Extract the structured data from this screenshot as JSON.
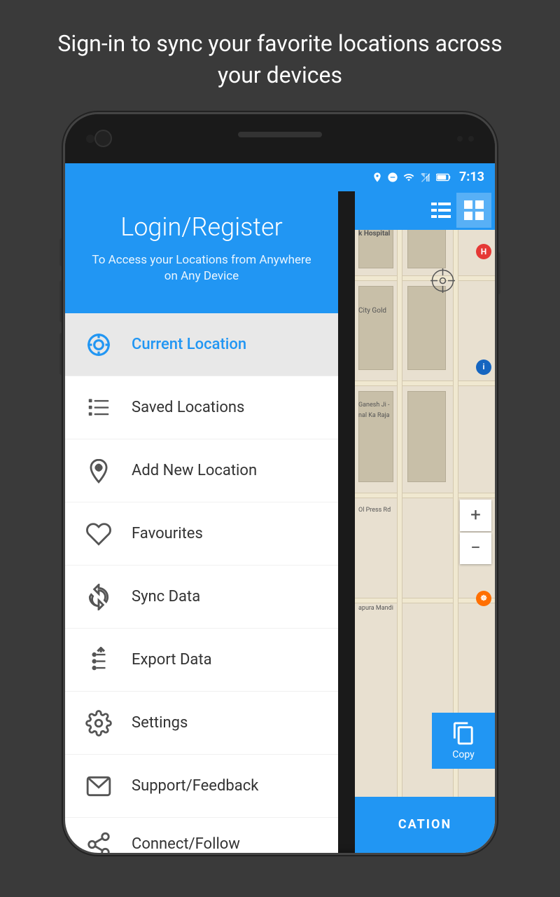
{
  "promo": {
    "text": "Sign-in to sync your favorite locations across your devices"
  },
  "status_bar": {
    "time": "7:13",
    "icons": [
      "location",
      "minus-circle",
      "wifi",
      "signal",
      "battery"
    ]
  },
  "header": {
    "title": "Login/Register",
    "subtitle": "To Access your Locations from Anywhere on Any Device"
  },
  "menu": {
    "items": [
      {
        "id": "current-location",
        "label": "Current Location",
        "icon": "target",
        "active": true
      },
      {
        "id": "saved-locations",
        "label": "Saved Locations",
        "icon": "list",
        "active": false
      },
      {
        "id": "add-new-location",
        "label": "Add New Location",
        "icon": "pin-plus",
        "active": false
      },
      {
        "id": "favourites",
        "label": "Favourites",
        "icon": "heart",
        "active": false
      },
      {
        "id": "sync-data",
        "label": "Sync Data",
        "icon": "sync",
        "active": false
      },
      {
        "id": "export-data",
        "label": "Export Data",
        "icon": "export",
        "active": false
      },
      {
        "id": "settings",
        "label": "Settings",
        "icon": "gear",
        "active": false
      },
      {
        "id": "support-feedback",
        "label": "Support/Feedback",
        "icon": "mail",
        "active": false
      },
      {
        "id": "connect",
        "label": "Connect/Follow",
        "icon": "share",
        "active": false
      }
    ]
  },
  "map": {
    "labels": [
      "k Hospital",
      "City Gold",
      "Ganesh Ji -",
      "nal Ka Raja",
      "Ol Press Rd",
      "apura Mandi"
    ],
    "zoom_in": "+",
    "zoom_out": "−"
  },
  "copy_button": {
    "label": "Copy"
  },
  "bottom_label": "CATION"
}
